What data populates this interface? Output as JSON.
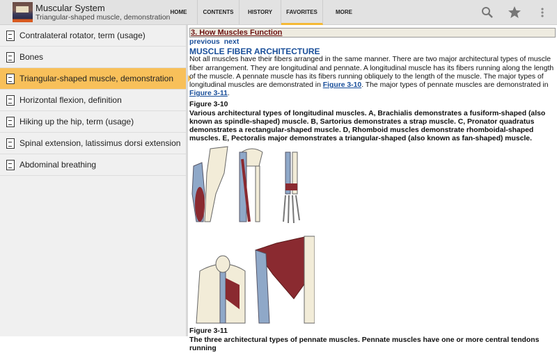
{
  "header": {
    "title": "Muscular System",
    "subtitle": "Triangular-shaped muscle, demonstration",
    "tabs": [
      "HOME",
      "CONTENTS",
      "HISTORY",
      "FAVORITES",
      "MORE"
    ],
    "selected_tab": "FAVORITES",
    "icons": [
      "search-icon",
      "star-icon",
      "overflow-menu-icon"
    ]
  },
  "sidebar": {
    "items": [
      "Contralateral rotator, term (usage)",
      "Bones",
      "Triangular-shaped muscle, demonstration",
      "Horizontal flexion, definition",
      "Hiking up the hip, term (usage)",
      "Spinal extension, latissimus dorsi extension",
      "Abdominal breathing"
    ],
    "selected_index": 2
  },
  "content": {
    "section": "3. How Muscles Function",
    "previous": "previous",
    "next": "next",
    "heading": "MUSCLE FIBER ARCHITECTURE",
    "para_a": "Not all muscles have their fibers arranged in the same manner. There are two major architectural types of muscle fiber arrangement. They are longitudinal and pennate. A longitudinal muscle has its fibers running along the length of the muscle. A pennate muscle has its fibers running obliquely to the length of the muscle. The major types of longitudinal muscles are demonstrated in ",
    "link1": "Figure 3-10",
    "para_b": ". The major types of pennate muscles are demonstrated in ",
    "link2": "Figure 3-11",
    "para_c": ".",
    "fig1_title": "Figure 3-10",
    "fig1_caption": "Various architectural types of longitudinal muscles. A, Brachialis demonstrates a fusiform-shaped (also known as spindle-shaped) muscle. B, Sartorius demonstrates a strap muscle. C, Pronator quadratus demonstrates a rectangular-shaped muscle. D, Rhomboid muscles demonstrate rhomboidal-shaped muscles. E, Pectoralis major demonstrates a triangular-shaped (also known as fan-shaped) muscle.",
    "fig2_title": "Figure 3-11",
    "fig2_caption": "The three architectural types of pennate muscles. Pennate muscles have one or more central tendons running"
  },
  "colors": {
    "accent": "#f8c05a",
    "link": "#1a4f9a",
    "section": "#6b1010",
    "muscle": "#8a2a30",
    "bone": "#f2ecd8"
  }
}
